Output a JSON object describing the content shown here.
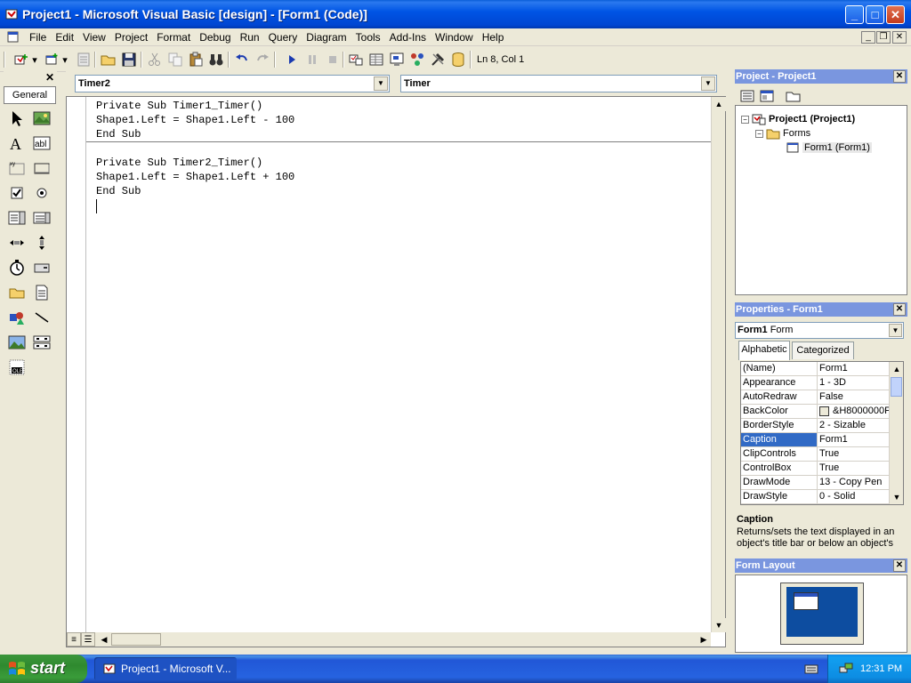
{
  "titlebar": {
    "title": "Project1 - Microsoft Visual Basic [design] - [Form1 (Code)]"
  },
  "menubar": {
    "items": [
      "File",
      "Edit",
      "View",
      "Project",
      "Format",
      "Debug",
      "Run",
      "Query",
      "Diagram",
      "Tools",
      "Add-Ins",
      "Window",
      "Help"
    ]
  },
  "toolbar": {
    "cursor_position": "Ln 8, Col 1"
  },
  "toolbox": {
    "tab_label": "General"
  },
  "code_window": {
    "object_combo": "Timer2",
    "procedure_combo": "Timer",
    "lines": [
      "Private Sub Timer1_Timer()",
      "Shape1.Left = Shape1.Left - 100",
      "End Sub",
      "Private Sub Timer2_Timer()",
      "Shape1.Left = Shape1.Left + 100",
      "End Sub"
    ]
  },
  "project_panel": {
    "title": "Project - Project1",
    "tree": {
      "root": "Project1 (Project1)",
      "folder": "Forms",
      "item": "Form1 (Form1)"
    }
  },
  "properties_panel": {
    "title": "Properties - Form1",
    "object_name": "Form1",
    "object_type": "Form",
    "tabs": [
      "Alphabetic",
      "Categorized"
    ],
    "rows": [
      {
        "name": "(Name)",
        "value": "Form1"
      },
      {
        "name": "Appearance",
        "value": "1 - 3D"
      },
      {
        "name": "AutoRedraw",
        "value": "False"
      },
      {
        "name": "BackColor",
        "value": "&H8000000F"
      },
      {
        "name": "BorderStyle",
        "value": "2 - Sizable"
      },
      {
        "name": "Caption",
        "value": "Form1"
      },
      {
        "name": "ClipControls",
        "value": "True"
      },
      {
        "name": "ControlBox",
        "value": "True"
      },
      {
        "name": "DrawMode",
        "value": "13 - Copy Pen"
      },
      {
        "name": "DrawStyle",
        "value": "0 - Solid"
      }
    ],
    "selected_row": "Caption",
    "desc_title": "Caption",
    "desc_text": "Returns/sets the text displayed in an object's title bar or below an object's"
  },
  "form_layout_panel": {
    "title": "Form Layout"
  },
  "taskbar": {
    "start_label": "start",
    "task_item": "Project1 - Microsoft V...",
    "clock": "12:31 PM"
  },
  "colors": {
    "title_blue": "#0055e5",
    "panel_title": "#7a96df",
    "selection": "#316ac5",
    "taskbar_blue": "#2663e0",
    "start_green": "#3a9c3a"
  }
}
